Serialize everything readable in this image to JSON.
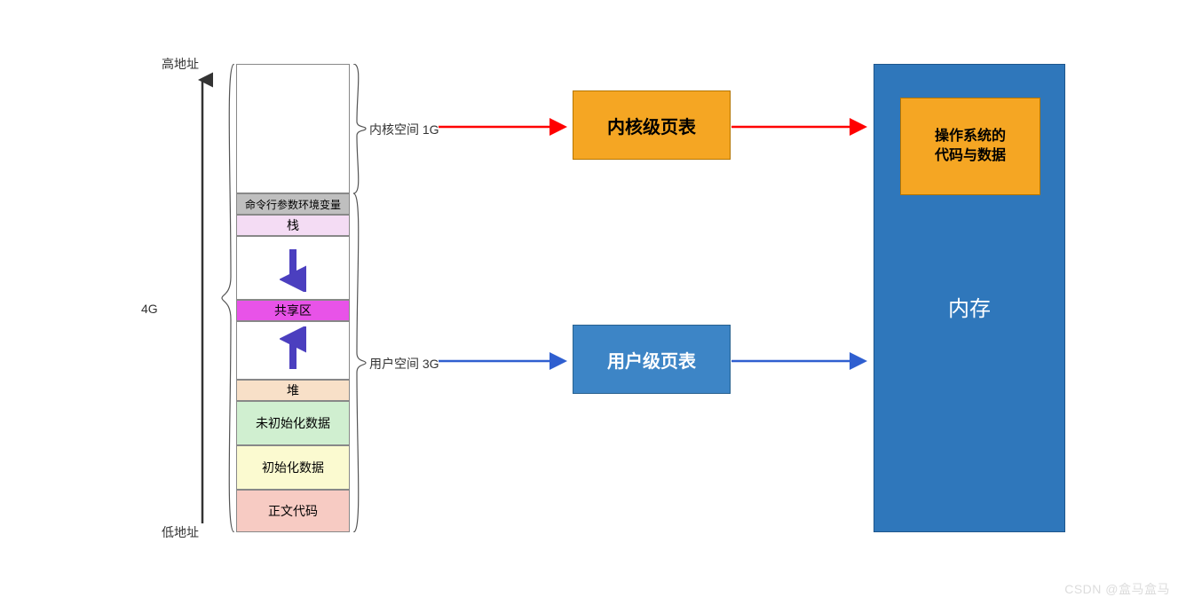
{
  "labels": {
    "highAddr": "高地址",
    "lowAddr": "低地址",
    "fourG": "4G",
    "kernelSpace": "内核空间 1G",
    "userSpace": "用户空间 3G",
    "kernelTable": "内核级页表",
    "userTable": "用户级页表",
    "osCodeData": "操作系统的\n代码与数据",
    "memory": "内存"
  },
  "segments": {
    "args": "命令行参数环境变量",
    "stack": "栈",
    "shared": "共享区",
    "heap": "堆",
    "bss": "未初始化数据",
    "data": "初始化数据",
    "text": "正文代码"
  },
  "colors": {
    "gray": "#bfbfbf",
    "pink": "#f4dcf4",
    "magenta": "#e853e8",
    "peach": "#f8e0c8",
    "green": "#d0efd0",
    "yellow": "#fbfad0",
    "salmon": "#f7cbc3",
    "orange": "#f5a623",
    "blue": "#2f77bb",
    "blueMid": "#3d85c6",
    "red": "#ff0000",
    "blueArrow": "#2f5fd0",
    "purpleArrow": "#4b3fbf"
  },
  "watermark": "CSDN @盒马盒马"
}
